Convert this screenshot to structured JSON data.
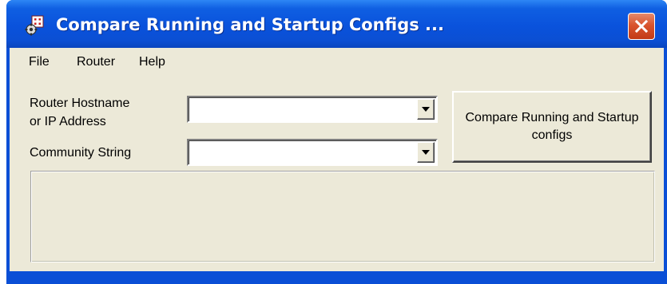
{
  "window": {
    "title": "Compare Running and Startup Configs ...",
    "icon": "app-config-icon",
    "close_icon": "close-icon"
  },
  "menu": {
    "items": [
      {
        "label": "File"
      },
      {
        "label": "Router"
      },
      {
        "label": "Help"
      }
    ]
  },
  "form": {
    "hostname": {
      "label_line1": "Router Hostname",
      "label_line2": "or IP Address",
      "value": ""
    },
    "community": {
      "label": "Community String",
      "value": ""
    }
  },
  "actions": {
    "compare_label": "Compare Running and Startup configs"
  },
  "status": {
    "text": ""
  },
  "colors": {
    "titlebar": "#0a52dc",
    "client_bg": "#ece9d8",
    "close_button": "#d9542e"
  }
}
